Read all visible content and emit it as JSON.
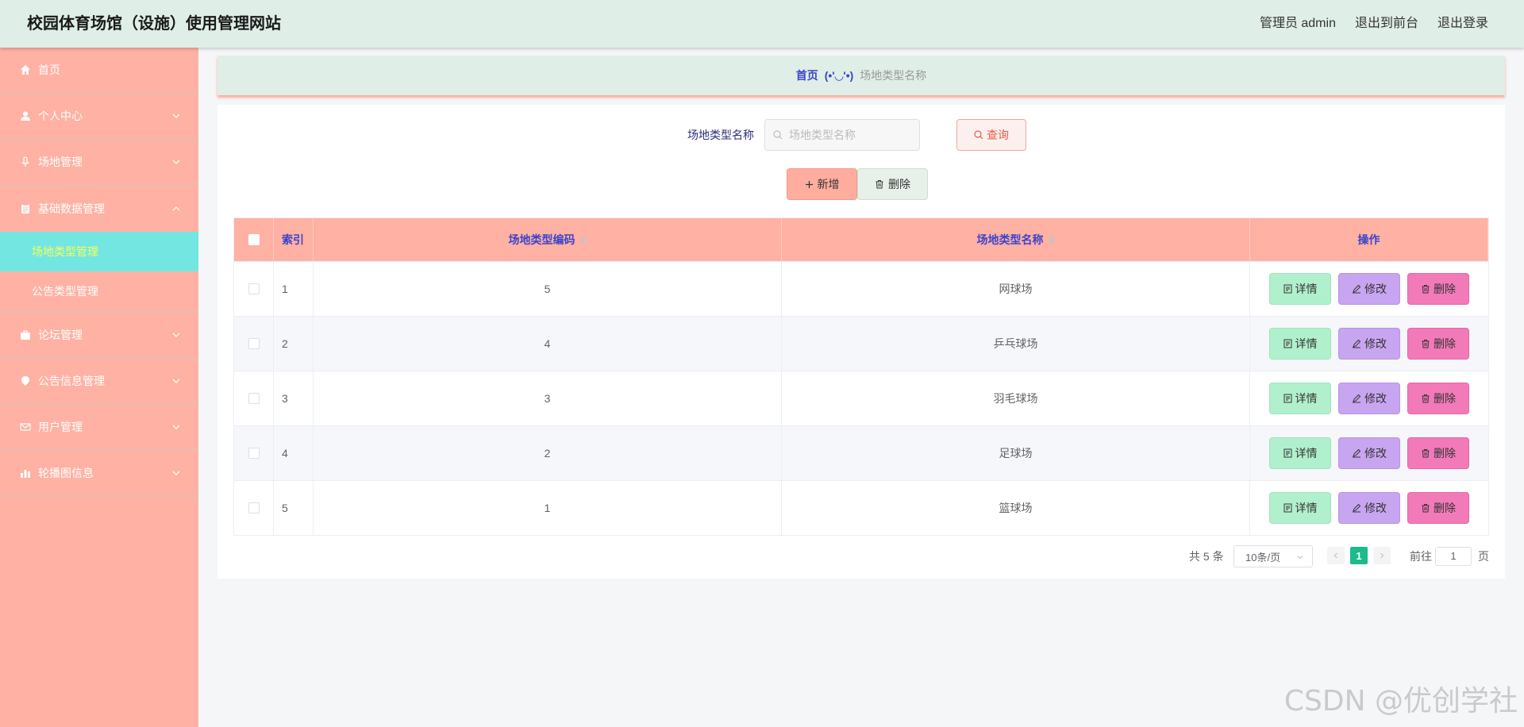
{
  "header": {
    "site_title": "校园体育场馆（设施）使用管理网站",
    "user": "管理员 admin",
    "to_front": "退出到前台",
    "logout": "退出登录"
  },
  "sidebar": {
    "items": [
      {
        "label": "首页",
        "icon": "home-icon"
      },
      {
        "label": "个人中心",
        "icon": "user-icon"
      },
      {
        "label": "场地管理",
        "icon": "microphone-icon"
      },
      {
        "label": "基础数据管理",
        "icon": "clipboard-icon"
      },
      {
        "label": "论坛管理",
        "icon": "briefcase-icon"
      },
      {
        "label": "公告信息管理",
        "icon": "location-icon"
      },
      {
        "label": "用户管理",
        "icon": "mail-icon"
      },
      {
        "label": "轮播图信息",
        "icon": "bar-chart-icon"
      }
    ],
    "sub_items": [
      {
        "label": "场地类型管理",
        "active": true
      },
      {
        "label": "公告类型管理",
        "active": false
      }
    ]
  },
  "breadcrumb": {
    "home": "首页",
    "face": "(•'◡'•)",
    "current": "场地类型名称"
  },
  "search": {
    "label": "场地类型名称",
    "placeholder": "场地类型名称",
    "query_label": "查询"
  },
  "actions": {
    "add_label": "新增",
    "delete_label": "删除"
  },
  "table": {
    "columns": [
      "索引",
      "场地类型编码",
      "场地类型名称",
      "操作"
    ],
    "rows": [
      {
        "index": "1",
        "code": "5",
        "name": "网球场"
      },
      {
        "index": "2",
        "code": "4",
        "name": "乒乓球场"
      },
      {
        "index": "3",
        "code": "3",
        "name": "羽毛球场"
      },
      {
        "index": "4",
        "code": "2",
        "name": "足球场"
      },
      {
        "index": "5",
        "code": "1",
        "name": "篮球场"
      }
    ],
    "op_labels": {
      "detail": "详情",
      "edit": "修改",
      "delete": "删除"
    }
  },
  "pagination": {
    "total": "共 5 条",
    "page_size": "10条/页",
    "current_page": "1",
    "goto_label": "前往",
    "goto_value": "1",
    "page_unit": "页"
  },
  "watermark": "CSDN @优创学社",
  "colors": {
    "sidebar_bg": "#ffb1a3",
    "active_sub_bg": "#74e6e1",
    "header_bg": "#dfeee6",
    "accent_blue": "#3b44c9",
    "pager_active": "#1cba8c"
  }
}
